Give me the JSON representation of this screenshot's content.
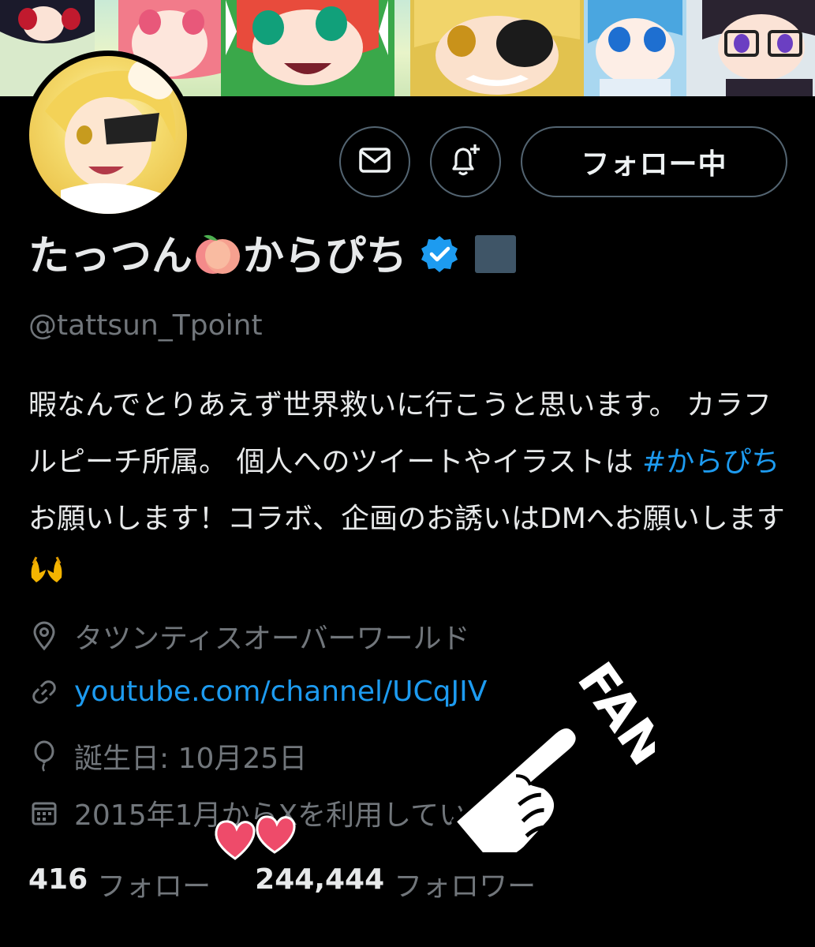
{
  "profile": {
    "name_part1": "たっつん",
    "name_part2": "からぴち",
    "handle": "@tattsun_Tpoint",
    "follow_label": "フォロー中",
    "bio": {
      "text1": "暇なんでとりあえず世界救いに行こうと思います。 カラフルピーチ所属。 個人へのツイートやイラストは ",
      "hashtag": "#からぴち",
      "text2": " お願いします！コラボ、企画のお誘いはDMへお願いします"
    },
    "location": "タツンティスオーバーワールド",
    "link": "youtube.com/channel/UCqJIV",
    "birthday": "誕生日: 10月25日",
    "joined": "2015年1月からXを利用しています",
    "following_count": "416",
    "following_label": "フォロー",
    "followers_count": "244,444",
    "followers_label": "フォロワー"
  },
  "sticker": {
    "text": "FAN"
  },
  "colors": {
    "accent": "#1d9bf0",
    "muted": "#71767b",
    "text": "#e7e9ea",
    "border": "#536471",
    "affiliate": "#3f5567"
  },
  "icons": [
    "mail-icon",
    "bell-plus-icon",
    "verified-badge-icon",
    "location-pin-icon",
    "link-icon",
    "balloon-icon",
    "calendar-icon",
    "peach-emoji",
    "hands-emoji"
  ]
}
